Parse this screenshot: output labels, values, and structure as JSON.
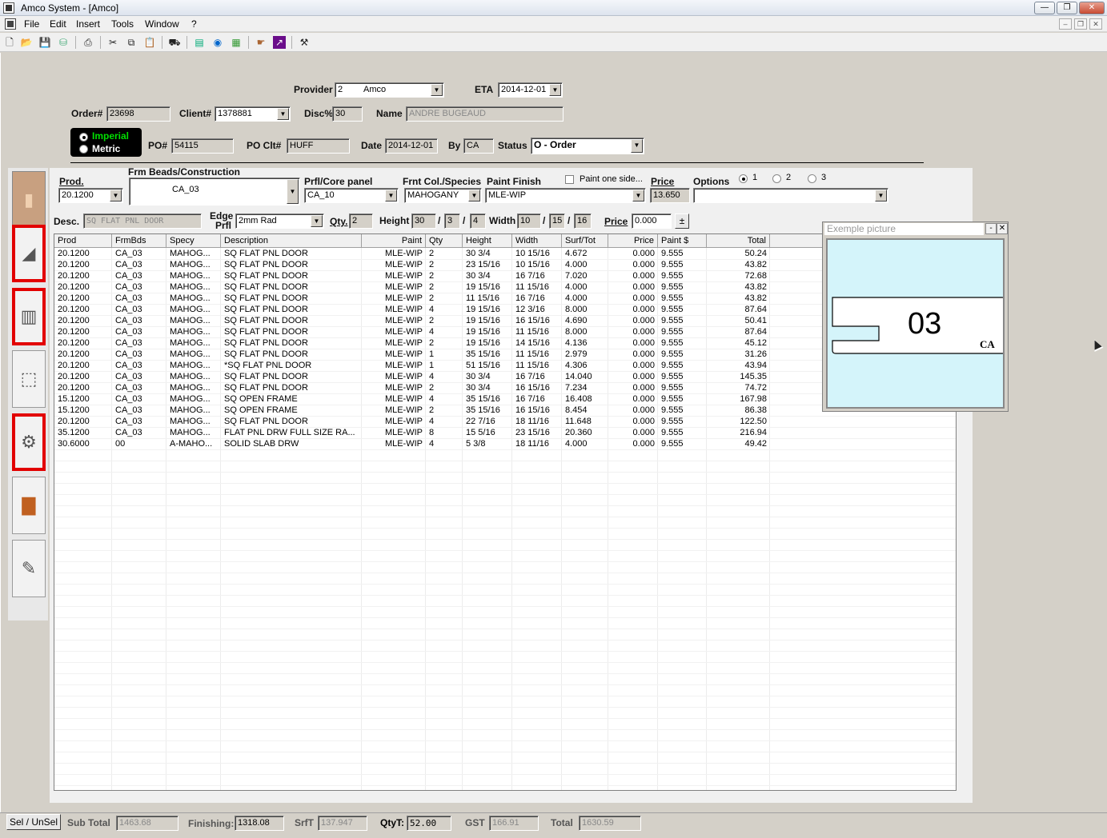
{
  "window": {
    "title": "Amco System - [Amco]",
    "min": "—",
    "max": "❐",
    "close": "✕"
  },
  "menu": [
    "File",
    "Edit",
    "Insert",
    "Tools",
    "Window",
    "?"
  ],
  "mdi_controls": [
    "–",
    "❐",
    "✕"
  ],
  "toolbar_icons": [
    "new-icon",
    "open-icon",
    "save-icon",
    "database-icon",
    "print-icon",
    "cut-icon",
    "copy-icon",
    "paste-icon",
    "truck-icon",
    "report-icon",
    "globe-icon",
    "calculator-icon",
    "hand-icon",
    "chart-icon",
    "tools-icon"
  ],
  "header": {
    "provider_label": "Provider",
    "provider_num": "2",
    "provider_name": "Amco",
    "eta_label": "ETA",
    "eta": "2014-12-01",
    "order_label": "Order#",
    "order": "23698",
    "client_label": "Client#",
    "client": "1378881",
    "disc_label": "Disc%",
    "disc": "30",
    "name_label": "Name",
    "name": "ANDRE BUGEAUD",
    "imperial": "Imperial",
    "metric": "Metric",
    "po_label": "PO#",
    "po": "54115",
    "poclt_label": "PO Clt#",
    "poclt": "HUFF",
    "date_label": "Date",
    "date": "2014-12-01",
    "by_label": "By",
    "by": "CA",
    "status_label": "Status",
    "status": "O - Order"
  },
  "entry": {
    "prod_label": "Prod.",
    "prod": "20.1200",
    "frm_label": "Frm Beads/Construction",
    "frm": "CA_03",
    "prfl_label": "Prfl/Core panel",
    "prfl": "CA_10",
    "frnt_label": "Frnt Col./Species",
    "frnt": "MAHOGANY",
    "paint_label": "Paint Finish",
    "paint": "MLE-WIP",
    "paint_one_side": "Paint one side...",
    "price_label": "Price",
    "price": "13.650",
    "options_label": "Options",
    "option_radios": [
      "1",
      "2",
      "3"
    ],
    "desc_label": "Desc.",
    "desc": "SQ FLAT PNL DOOR",
    "edge_label_1": "Edge",
    "edge_label_2": "Prfl",
    "edge": "2mm Rad",
    "qty_label": "Qty.",
    "qty": "2",
    "height_label": "Height",
    "height_w": "30",
    "height_n": "3",
    "height_d": "4",
    "width_label": "Width",
    "width_w": "10",
    "width_n": "15",
    "width_d": "16",
    "price2_label": "Price",
    "price2": "0.000",
    "pm_button": "±",
    "slash": "/"
  },
  "grid": {
    "columns": [
      "Prod",
      "FrmBds",
      "Specy",
      "Description",
      "Paint",
      "Qty",
      "Height",
      "Width",
      "Surf/Tot",
      "Price",
      "Paint $",
      "Total"
    ],
    "rows": [
      [
        "20.1200",
        "CA_03",
        "MAHOG...",
        "SQ FLAT PNL DOOR",
        "MLE-WIP",
        "2",
        "30  3/4",
        "10 15/16",
        "4.672",
        "0.000",
        "9.555",
        "50.24"
      ],
      [
        "20.1200",
        "CA_03",
        "MAHOG...",
        "SQ FLAT PNL DOOR",
        "MLE-WIP",
        "2",
        "23 15/16",
        "10 15/16",
        "4.000",
        "0.000",
        "9.555",
        "43.82"
      ],
      [
        "20.1200",
        "CA_03",
        "MAHOG...",
        "SQ FLAT PNL DOOR",
        "MLE-WIP",
        "2",
        "30  3/4",
        "16  7/16",
        "7.020",
        "0.000",
        "9.555",
        "72.68"
      ],
      [
        "20.1200",
        "CA_03",
        "MAHOG...",
        "SQ FLAT PNL DOOR",
        "MLE-WIP",
        "2",
        "19 15/16",
        "11 15/16",
        "4.000",
        "0.000",
        "9.555",
        "43.82"
      ],
      [
        "20.1200",
        "CA_03",
        "MAHOG...",
        "SQ FLAT PNL DOOR",
        "MLE-WIP",
        "2",
        "11 15/16",
        "16  7/16",
        "4.000",
        "0.000",
        "9.555",
        "43.82"
      ],
      [
        "20.1200",
        "CA_03",
        "MAHOG...",
        "SQ FLAT PNL DOOR",
        "MLE-WIP",
        "4",
        "19 15/16",
        "12  3/16",
        "8.000",
        "0.000",
        "9.555",
        "87.64"
      ],
      [
        "20.1200",
        "CA_03",
        "MAHOG...",
        "SQ FLAT PNL DOOR",
        "MLE-WIP",
        "2",
        "19 15/16",
        "16 15/16",
        "4.690",
        "0.000",
        "9.555",
        "50.41"
      ],
      [
        "20.1200",
        "CA_03",
        "MAHOG...",
        "SQ FLAT PNL DOOR",
        "MLE-WIP",
        "4",
        "19 15/16",
        "11 15/16",
        "8.000",
        "0.000",
        "9.555",
        "87.64"
      ],
      [
        "20.1200",
        "CA_03",
        "MAHOG...",
        "SQ FLAT PNL DOOR",
        "MLE-WIP",
        "2",
        "19 15/16",
        "14 15/16",
        "4.136",
        "0.000",
        "9.555",
        "45.12"
      ],
      [
        "20.1200",
        "CA_03",
        "MAHOG...",
        "SQ FLAT PNL DOOR",
        "MLE-WIP",
        "1",
        "35 15/16",
        "11 15/16",
        "2.979",
        "0.000",
        "9.555",
        "31.26"
      ],
      [
        "20.1200",
        "CA_03",
        "MAHOG...",
        "*SQ FLAT PNL DOOR",
        "MLE-WIP",
        "1",
        "51 15/16",
        "11 15/16",
        "4.306",
        "0.000",
        "9.555",
        "43.94"
      ],
      [
        "20.1200",
        "CA_03",
        "MAHOG...",
        "SQ FLAT PNL DOOR",
        "MLE-WIP",
        "4",
        "30  3/4",
        "16  7/16",
        "14.040",
        "0.000",
        "9.555",
        "145.35"
      ],
      [
        "20.1200",
        "CA_03",
        "MAHOG...",
        "SQ FLAT PNL DOOR",
        "MLE-WIP",
        "2",
        "30  3/4",
        "16 15/16",
        "7.234",
        "0.000",
        "9.555",
        "74.72"
      ],
      [
        "15.1200",
        "CA_03",
        "MAHOG...",
        "SQ OPEN FRAME",
        "MLE-WIP",
        "4",
        "35 15/16",
        "16  7/16",
        "16.408",
        "0.000",
        "9.555",
        "167.98"
      ],
      [
        "15.1200",
        "CA_03",
        "MAHOG...",
        "SQ OPEN FRAME",
        "MLE-WIP",
        "2",
        "35 15/16",
        "16 15/16",
        "8.454",
        "0.000",
        "9.555",
        "86.38"
      ],
      [
        "20.1200",
        "CA_03",
        "MAHOG...",
        "SQ FLAT PNL DOOR",
        "MLE-WIP",
        "4",
        "22  7/16",
        "18 11/16",
        "11.648",
        "0.000",
        "9.555",
        "122.50"
      ],
      [
        "35.1200",
        "CA_03",
        "MAHOG...",
        "FLAT PNL DRW FULL SIZE RA...",
        "MLE-WIP",
        "8",
        "15  5/16",
        "23 15/16",
        "20.360",
        "0.000",
        "9.555",
        "216.94"
      ],
      [
        "30.6000",
        "00",
        "A-MAHO...",
        "SOLID SLAB DRW",
        "MLE-WIP",
        "4",
        "5  3/8",
        "18 11/16",
        "4.000",
        "0.000",
        "9.555",
        "49.42"
      ]
    ]
  },
  "picture": {
    "title": "Exemple picture",
    "min": "-",
    "close": "✕",
    "code": "03",
    "sub": "CA"
  },
  "side_buttons": [
    "door-sample-icon",
    "panel-sample-icon",
    "shelf-sample-icon",
    "box-icon",
    "hinge-icon",
    "wood-finish-icon",
    "pencil-tool-icon"
  ],
  "footer": {
    "sel_button": "Sel / UnSel",
    "subtotal_label": "Sub Total",
    "subtotal": "1463.68",
    "finishing_label": "Finishing:",
    "finishing": "1318.08",
    "srft_label": "SrfT",
    "srft": "137.947",
    "qtyt_label": "QtyT:",
    "qtyt": "52.00",
    "gst_label": "GST",
    "gst": "166.91",
    "total_label": "Total",
    "total": "1630.59"
  },
  "colors": {
    "accent_green": "#00e000",
    "side_red": "#e20000",
    "picture_bg": "#d4f4fa"
  }
}
